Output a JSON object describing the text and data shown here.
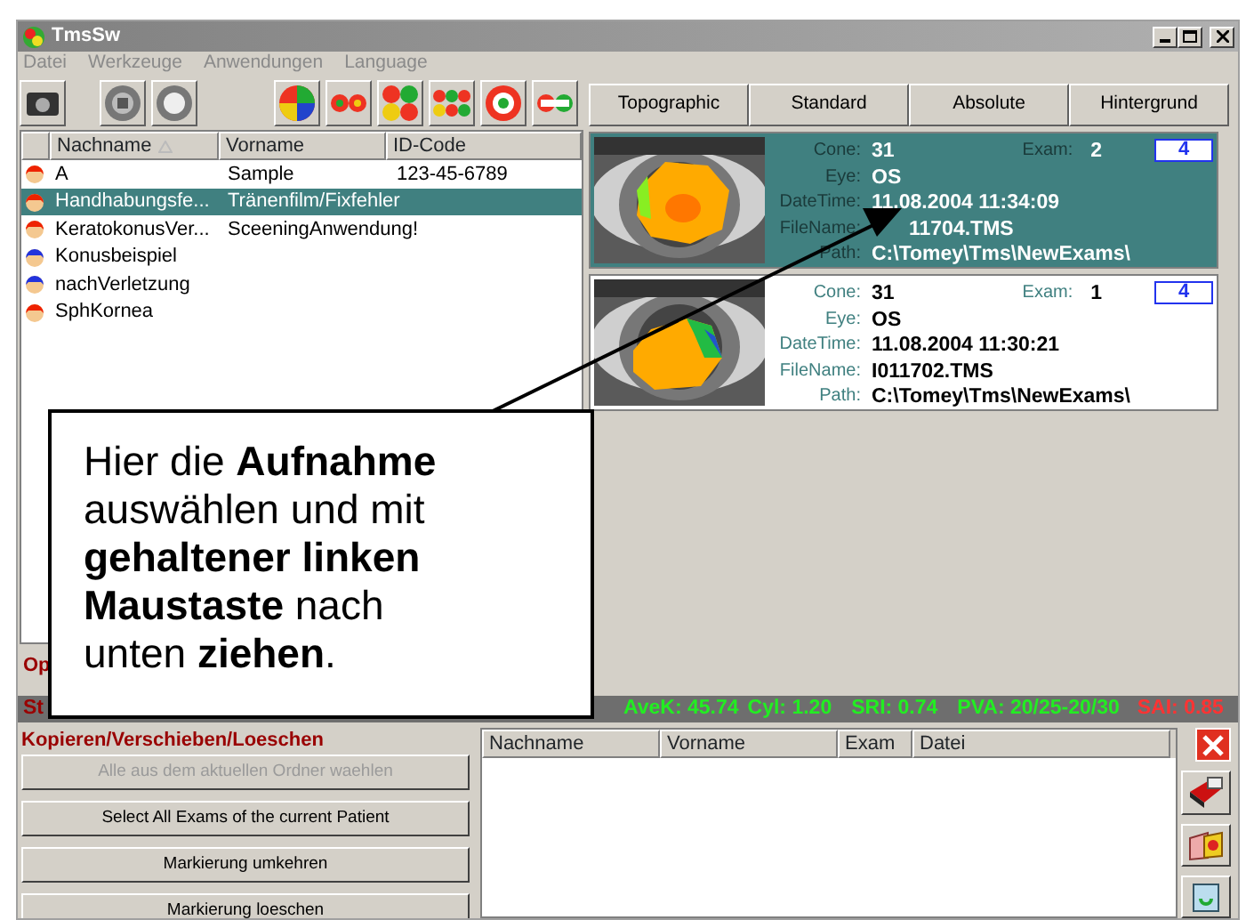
{
  "window": {
    "title": "TmsSw"
  },
  "menu": [
    "Datei",
    "Werkzeuge",
    "Anwendungen",
    "Language"
  ],
  "patient_list": {
    "columns": [
      "Nachname",
      "Vorname",
      "ID-Code"
    ],
    "rows": [
      {
        "nachname": "A",
        "vorname": "Sample",
        "id_code": "123-45-6789",
        "color": "#ee2200",
        "selected": false
      },
      {
        "nachname": "Handhabungsfe...",
        "vorname": "Tränenfilm/Fixfehler",
        "id_code": "",
        "color": "#ee2200",
        "selected": true
      },
      {
        "nachname": "KeratokonusVer...",
        "vorname": "SceeningAnwendung!",
        "id_code": "",
        "color": "#ee2200",
        "selected": false
      },
      {
        "nachname": "Konusbeispiel",
        "vorname": "",
        "id_code": "",
        "color": "#2233dd",
        "selected": false
      },
      {
        "nachname": "nachVerletzung",
        "vorname": "",
        "id_code": "",
        "color": "#2233dd",
        "selected": false
      },
      {
        "nachname": "SphKornea",
        "vorname": "",
        "id_code": "",
        "color": "#ee2200",
        "selected": false
      }
    ]
  },
  "partial_label": "Op",
  "view_buttons": [
    "Topographic",
    "Standard",
    "Absolute",
    "Hintergrund"
  ],
  "exams": [
    {
      "selected": true,
      "badge": "4",
      "fields": [
        {
          "label": "Cone:",
          "value": "31"
        },
        {
          "label": "Eye:",
          "value": "OS"
        },
        {
          "label": "DateTime:",
          "value": "11.08.2004 11:34:09"
        },
        {
          "label": "FileName:",
          "value": "11704.TMS",
          "partly_covered": true
        },
        {
          "label": "Path:",
          "value": "C:\\Tomey\\Tms\\NewExams\\"
        }
      ],
      "exam_label": "Exam:",
      "exam_value": "2"
    },
    {
      "selected": false,
      "badge": "4",
      "fields": [
        {
          "label": "Cone:",
          "value": "31"
        },
        {
          "label": "Eye:",
          "value": "OS"
        },
        {
          "label": "DateTime:",
          "value": "11.08.2004 11:30:21"
        },
        {
          "label": "FileName:",
          "value": "I011702.TMS"
        },
        {
          "label": "Path:",
          "value": "C:\\Tomey\\Tms\\NewExams\\"
        }
      ],
      "exam_label": "Exam:",
      "exam_value": "1"
    }
  ],
  "status_bar": {
    "partial_label": "St",
    "items": [
      {
        "text": "AveK: 45.74",
        "kind": "normal"
      },
      {
        "text": "Cyl: 1.20",
        "kind": "normal"
      },
      {
        "text": "SRI: 0.74",
        "kind": "normal"
      },
      {
        "text": "PVA: 20/25-20/30",
        "kind": "normal"
      },
      {
        "text": "SAI: 0.85",
        "kind": "alert"
      }
    ]
  },
  "copy_panel": {
    "title": "Kopieren/Verschieben/Loeschen",
    "buttons": [
      {
        "label": "Alle aus dem aktuellen Ordner waehlen",
        "disabled": true
      },
      {
        "label": "Select All Exams of the current Patient",
        "disabled": false
      },
      {
        "label": "Markierung umkehren",
        "disabled": false
      },
      {
        "label": "Markierung loeschen",
        "disabled": false
      }
    ]
  },
  "target_table": {
    "columns": [
      "Nachname",
      "Vorname",
      "Exam",
      "Datei"
    ]
  },
  "callout": {
    "text": "Hier die **Aufnahme** auswählen und mit **gehaltener linken Maustaste** nach unten **ziehen**."
  }
}
